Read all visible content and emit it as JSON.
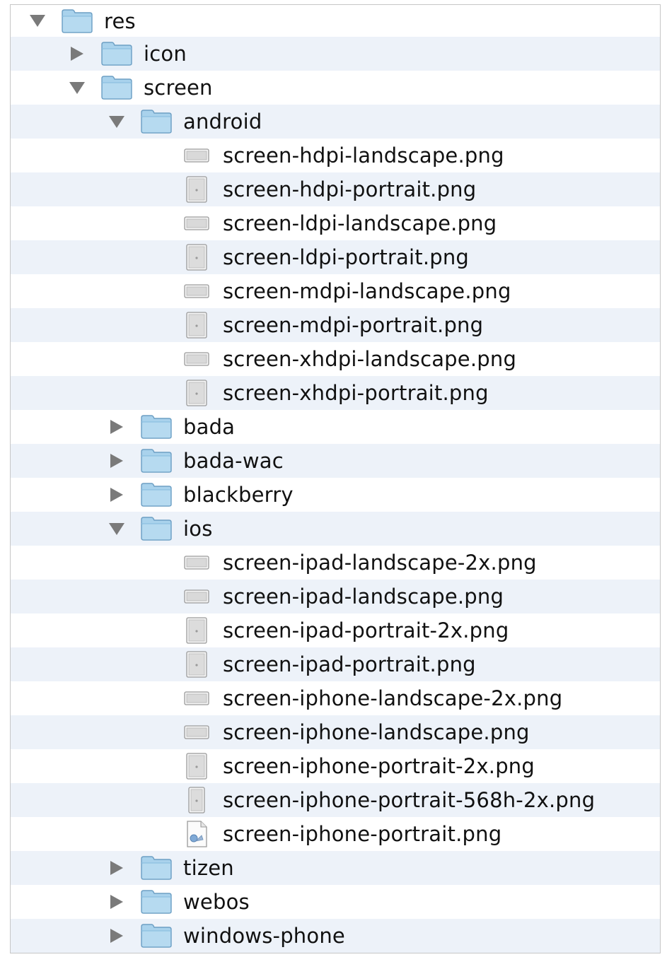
{
  "tree": {
    "rows": [
      {
        "label": "res",
        "kind": "folder",
        "depth": 0,
        "expanded": true
      },
      {
        "label": "icon",
        "kind": "folder",
        "depth": 1,
        "expanded": false
      },
      {
        "label": "screen",
        "kind": "folder",
        "depth": 1,
        "expanded": true
      },
      {
        "label": "android",
        "kind": "folder",
        "depth": 2,
        "expanded": true
      },
      {
        "label": "screen-hdpi-landscape.png",
        "kind": "png-landscape",
        "depth": 3
      },
      {
        "label": "screen-hdpi-portrait.png",
        "kind": "png-portrait",
        "depth": 3
      },
      {
        "label": "screen-ldpi-landscape.png",
        "kind": "png-landscape",
        "depth": 3
      },
      {
        "label": "screen-ldpi-portrait.png",
        "kind": "png-portrait",
        "depth": 3
      },
      {
        "label": "screen-mdpi-landscape.png",
        "kind": "png-landscape",
        "depth": 3
      },
      {
        "label": "screen-mdpi-portrait.png",
        "kind": "png-portrait",
        "depth": 3
      },
      {
        "label": "screen-xhdpi-landscape.png",
        "kind": "png-landscape",
        "depth": 3
      },
      {
        "label": "screen-xhdpi-portrait.png",
        "kind": "png-portrait",
        "depth": 3
      },
      {
        "label": "bada",
        "kind": "folder",
        "depth": 2,
        "expanded": false
      },
      {
        "label": "bada-wac",
        "kind": "folder",
        "depth": 2,
        "expanded": false
      },
      {
        "label": "blackberry",
        "kind": "folder",
        "depth": 2,
        "expanded": false
      },
      {
        "label": "ios",
        "kind": "folder",
        "depth": 2,
        "expanded": true
      },
      {
        "label": "screen-ipad-landscape-2x.png",
        "kind": "png-landscape",
        "depth": 3
      },
      {
        "label": "screen-ipad-landscape.png",
        "kind": "png-landscape",
        "depth": 3
      },
      {
        "label": "screen-ipad-portrait-2x.png",
        "kind": "png-portrait",
        "depth": 3
      },
      {
        "label": "screen-ipad-portrait.png",
        "kind": "png-portrait",
        "depth": 3
      },
      {
        "label": "screen-iphone-landscape-2x.png",
        "kind": "png-landscape",
        "depth": 3
      },
      {
        "label": "screen-iphone-landscape.png",
        "kind": "png-landscape",
        "depth": 3
      },
      {
        "label": "screen-iphone-portrait-2x.png",
        "kind": "png-portrait",
        "depth": 3
      },
      {
        "label": "screen-iphone-portrait-568h-2x.png",
        "kind": "png-portrait-narrow",
        "depth": 3
      },
      {
        "label": "screen-iphone-portrait.png",
        "kind": "png-doc",
        "depth": 3
      },
      {
        "label": "tizen",
        "kind": "folder",
        "depth": 2,
        "expanded": false
      },
      {
        "label": "webos",
        "kind": "folder",
        "depth": 2,
        "expanded": false
      },
      {
        "label": "windows-phone",
        "kind": "folder",
        "depth": 2,
        "expanded": false
      }
    ]
  },
  "colors": {
    "row_stripe": "#edf2f9",
    "folder_body": "#a9d2ec",
    "folder_edge": "#6d9fc4",
    "disclosure": "#7a7a7a"
  },
  "icons": {
    "folder": "folder-icon",
    "png-landscape": "image-landscape-icon",
    "png-portrait": "image-portrait-icon",
    "png-portrait-narrow": "image-portrait-icon",
    "png-doc": "image-file-icon",
    "expanded": "disclosure-down-icon",
    "collapsed": "disclosure-right-icon"
  }
}
